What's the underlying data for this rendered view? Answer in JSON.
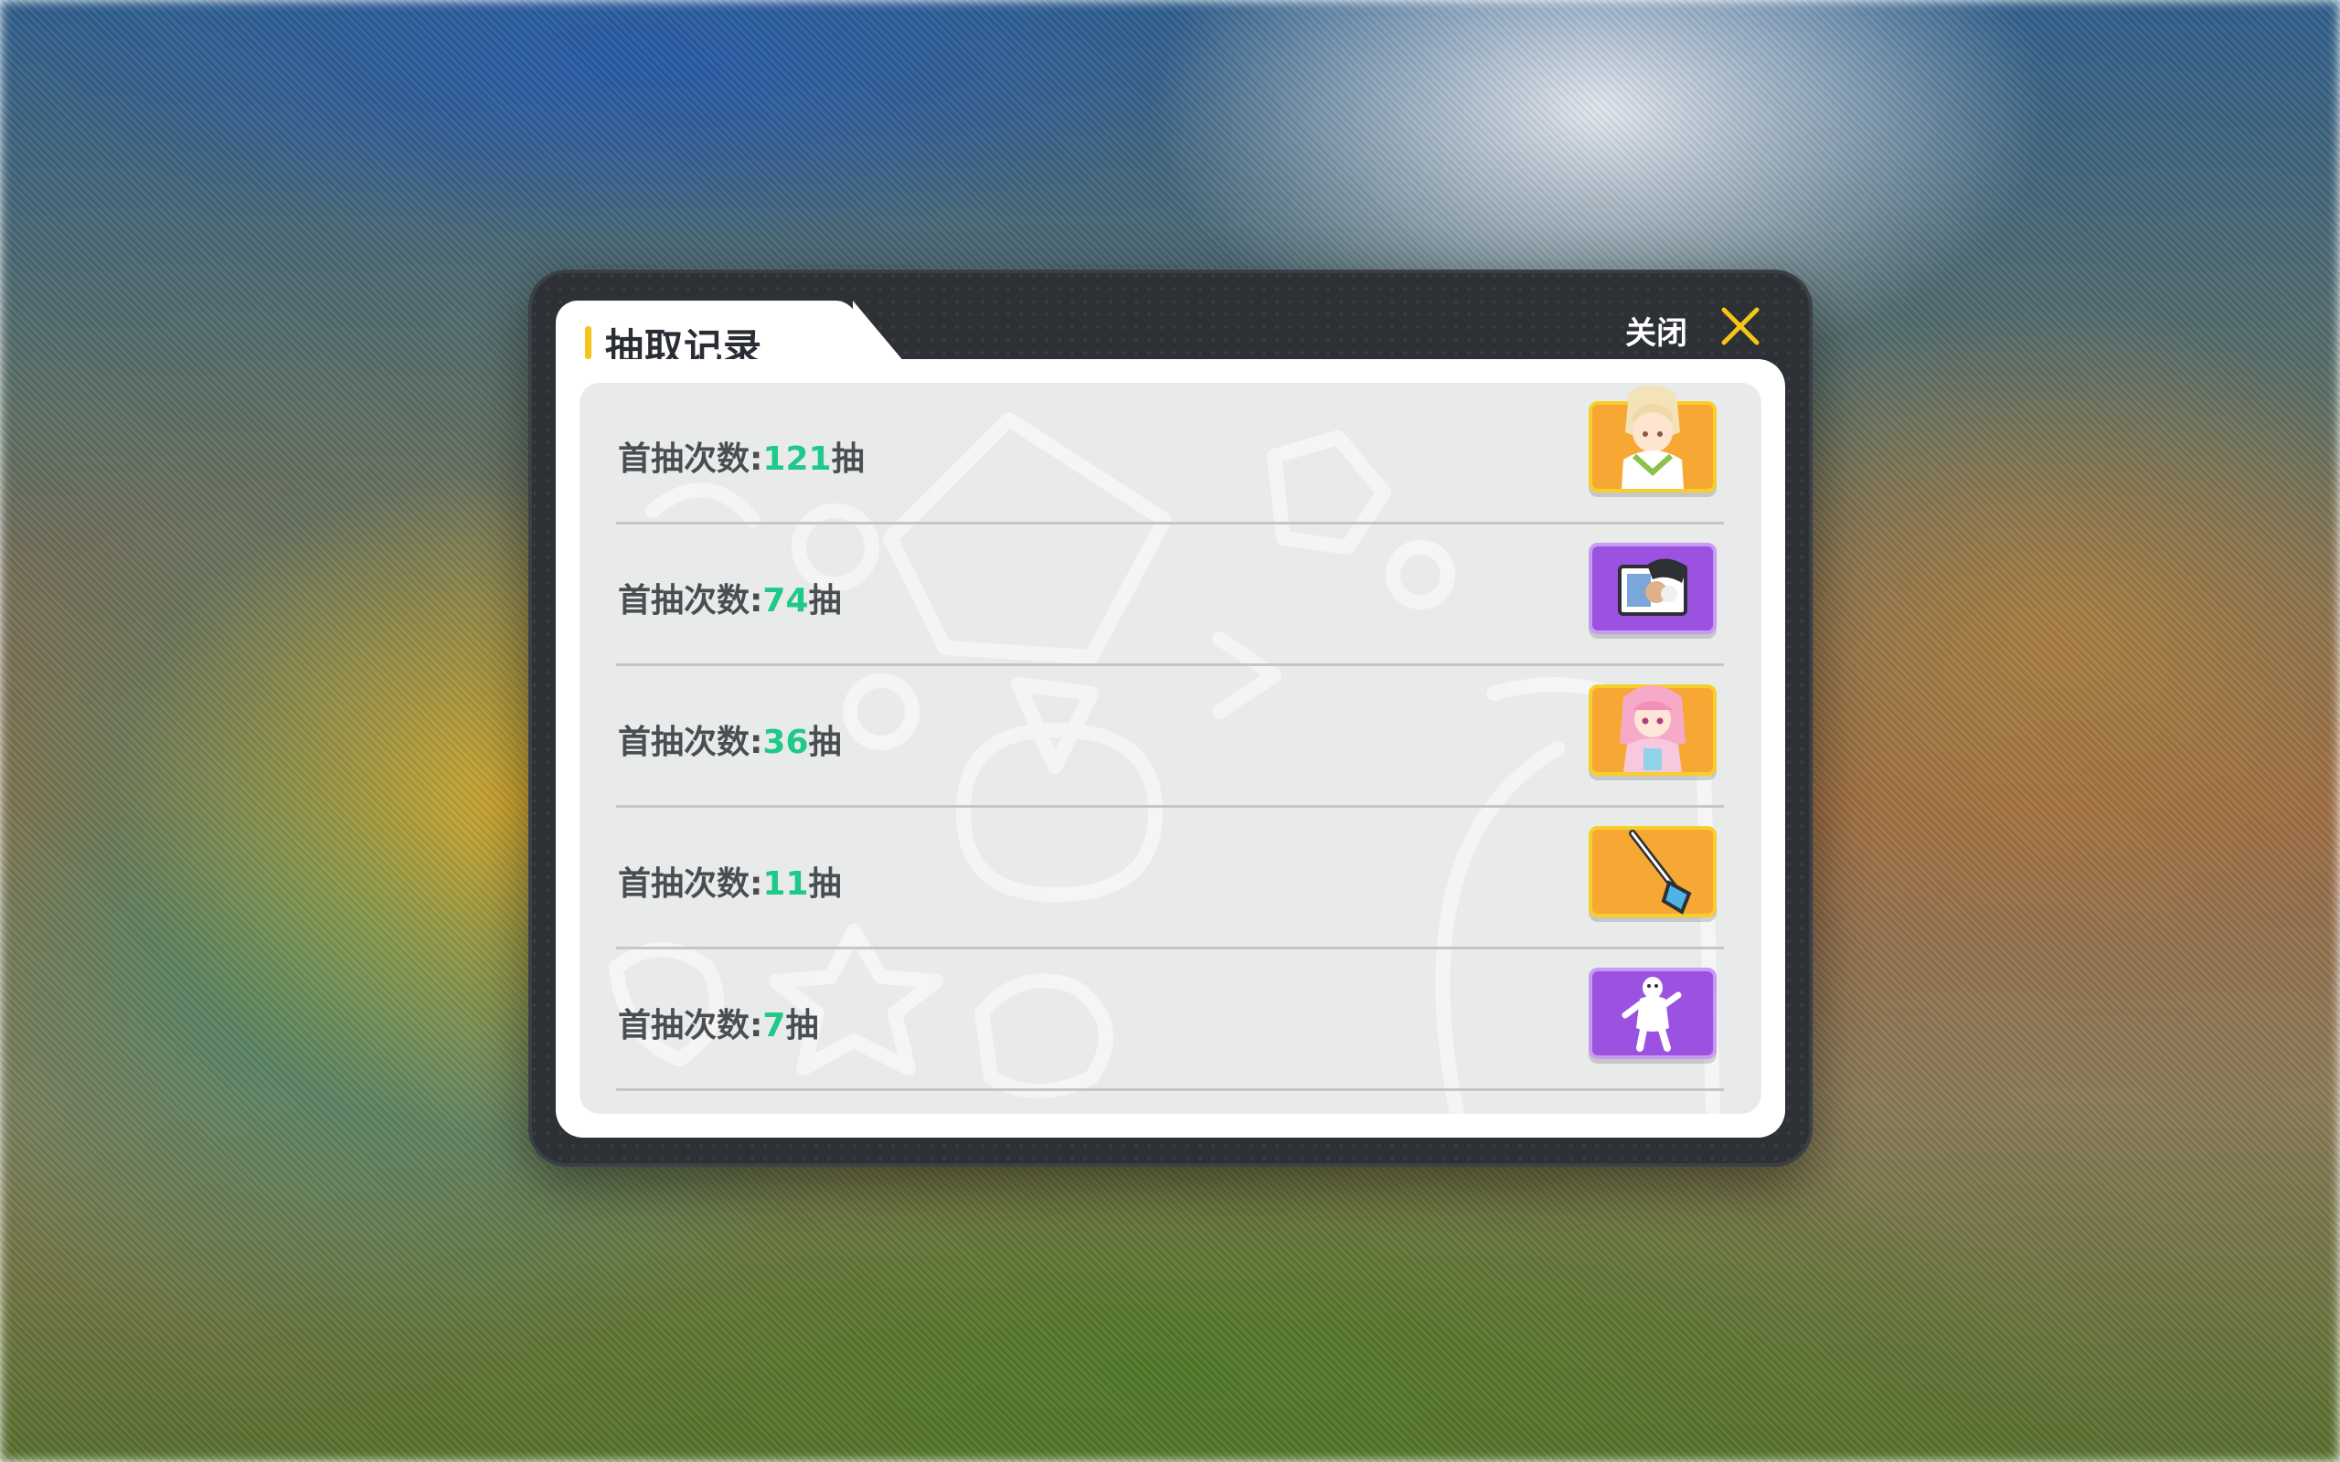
{
  "dialog": {
    "title": "抽取记录",
    "close_label": "关闭"
  },
  "records": [
    {
      "prefix": "首抽次数:",
      "count": "121",
      "suffix": "抽",
      "reward_icon": "blonde-character-portrait-icon",
      "rarity": "gold"
    },
    {
      "prefix": "首抽次数:",
      "count": "74",
      "suffix": "抽",
      "reward_icon": "photo-frame-item-icon",
      "rarity": "purple"
    },
    {
      "prefix": "首抽次数:",
      "count": "36",
      "suffix": "抽",
      "reward_icon": "pink-hair-character-portrait-icon",
      "rarity": "gold"
    },
    {
      "prefix": "首抽次数:",
      "count": "11",
      "suffix": "抽",
      "reward_icon": "tool-wand-item-icon",
      "rarity": "gold"
    },
    {
      "prefix": "首抽次数:",
      "count": "7",
      "suffix": "抽",
      "reward_icon": "white-figure-emote-icon",
      "rarity": "purple"
    }
  ],
  "colors": {
    "count_accent": "#1ec98a",
    "tab_accent": "#f5c518",
    "close_icon": "#f5c518",
    "rarity_gold": "#f7a733",
    "rarity_purple": "#9c52e0"
  }
}
